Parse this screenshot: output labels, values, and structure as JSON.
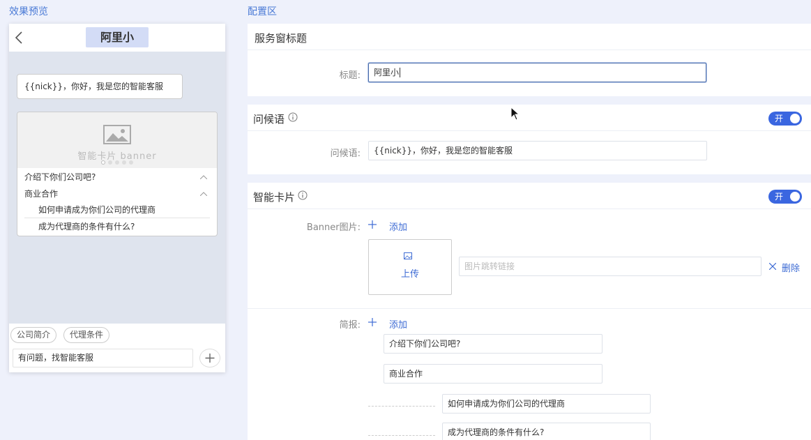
{
  "headers": {
    "preview": "效果预览",
    "config": "配置区"
  },
  "phone": {
    "title": "阿里小",
    "greeting": "{{nick}}，你好，我是您的智能客服",
    "banner_label": "智能卡片 banner",
    "questions": [
      {
        "label": "介绍下你们公司吧?"
      },
      {
        "label": "商业合作"
      }
    ],
    "sub_questions": [
      {
        "label": "如何申请成为你们公司的代理商"
      },
      {
        "label": "成为代理商的条件有什么?"
      }
    ],
    "quick_tags": [
      "公司简介",
      "代理条件"
    ],
    "input_text": "有问题，找智能客服"
  },
  "service_title": {
    "heading": "服务窗标题",
    "label": "标题:",
    "value": "阿里小"
  },
  "greeting_section": {
    "heading": "问候语",
    "toggle_label": "开",
    "label": "问候语:",
    "value": "{{nick}}，你好，我是您的智能客服"
  },
  "smart_card": {
    "heading": "智能卡片",
    "toggle_label": "开",
    "banner_label": "Banner图片:",
    "add_label": "添加",
    "upload_label": "上传",
    "link_placeholder": "图片跳转链接",
    "delete_label": "删除",
    "brief_label": "简报:",
    "brief_add_label": "添加",
    "brief_items": [
      "介绍下你们公司吧?",
      "商业合作"
    ],
    "brief_sub_items": [
      "如何申请成为你们公司的代理商",
      "成为代理商的条件有什么?"
    ]
  },
  "colors": {
    "accent": "#3a66e0",
    "link": "#3d6bd4",
    "header": "#4a7ad6",
    "background": "#eef1fb"
  },
  "icons": [
    "back-arrow-icon",
    "image-icon",
    "chevron-up-icon",
    "plus-icon",
    "info-icon",
    "close-icon",
    "upload-image-icon",
    "mouse-cursor-icon"
  ]
}
